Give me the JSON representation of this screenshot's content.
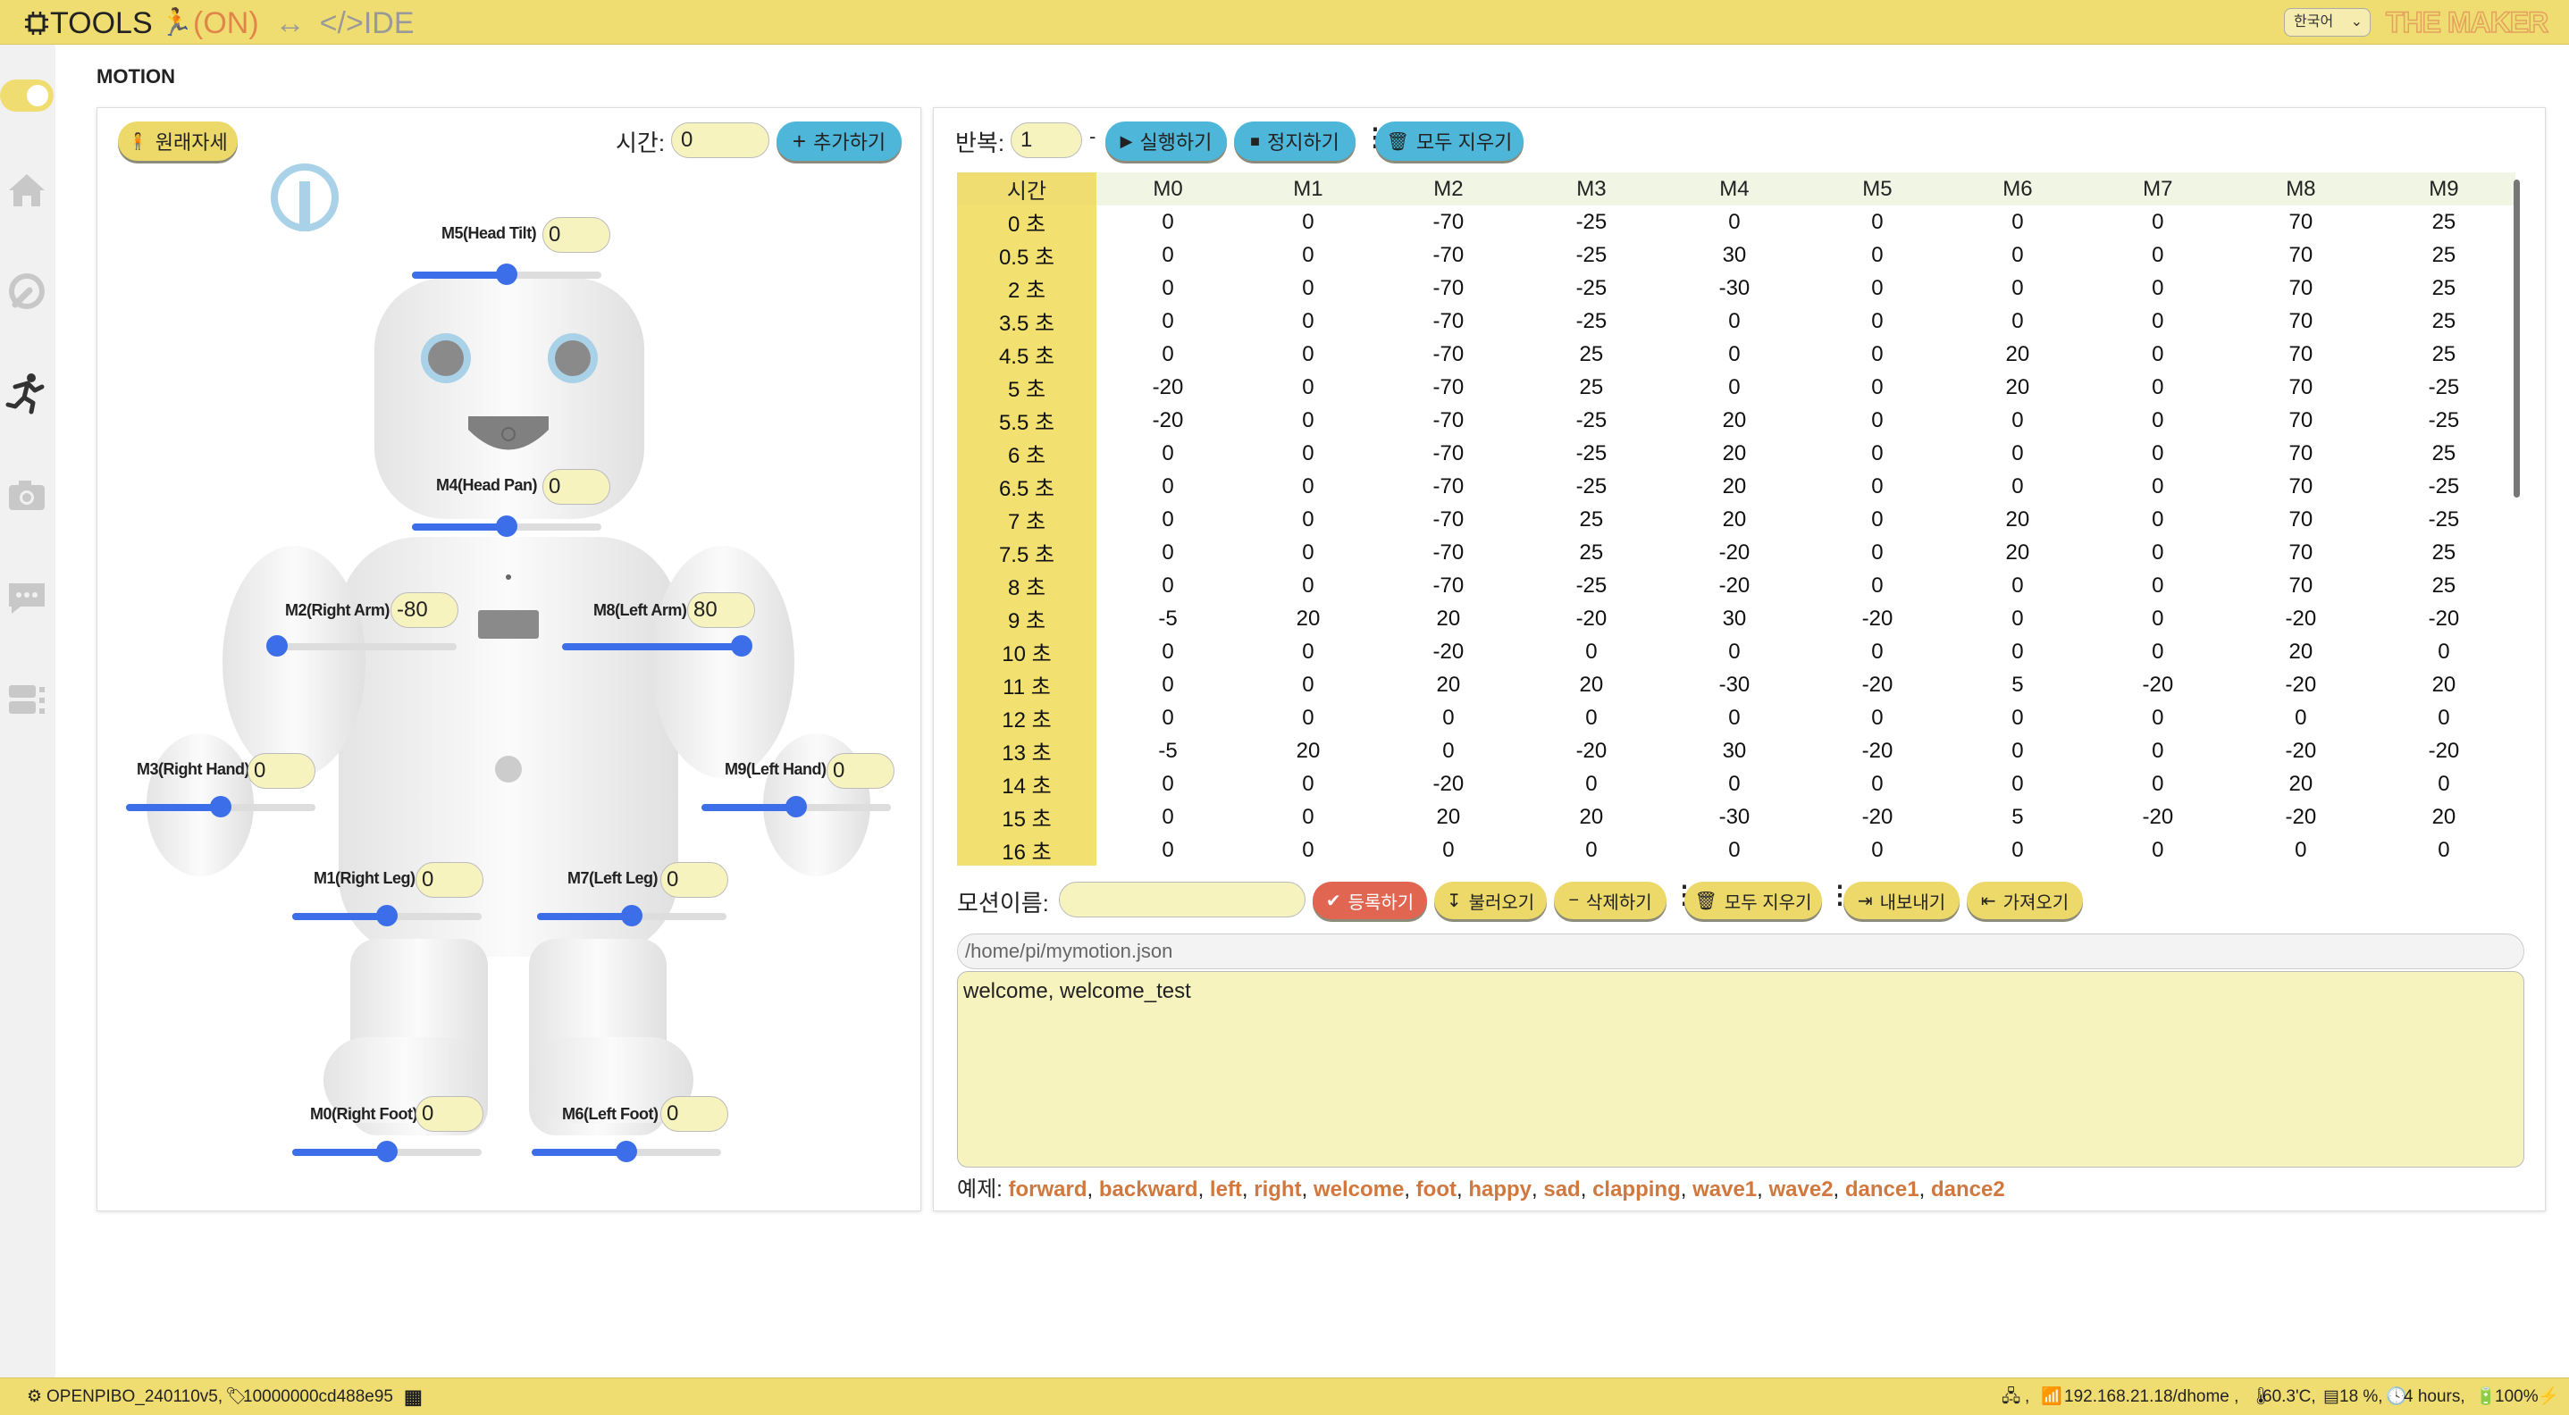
{
  "topbar": {
    "brand_main": "TOOLS",
    "brand_on": "(ON)",
    "brand_arrow": "↔",
    "brand_ide": "</>IDE",
    "language": "한국어",
    "logo": "THE MAKER"
  },
  "page": {
    "title": "MOTION"
  },
  "sidebar": {
    "items": [
      {
        "name": "home",
        "icon": "home-icon"
      },
      {
        "name": "tools",
        "icon": "wrench-icon"
      },
      {
        "name": "motion",
        "icon": "running-person-icon"
      },
      {
        "name": "camera",
        "icon": "camera-icon"
      },
      {
        "name": "chat",
        "icon": "chat-icon"
      },
      {
        "name": "devices",
        "icon": "device-icon"
      }
    ]
  },
  "left": {
    "reset_label": "원래자세",
    "time_label": "시간:",
    "time_value": "0",
    "add_label": "추가하기",
    "motors": [
      {
        "id": "m5",
        "label": "M5(Head Tilt)",
        "value": "0",
        "level": 0.5
      },
      {
        "id": "m4",
        "label": "M4(Head Pan)",
        "value": "0",
        "level": 0.5
      },
      {
        "id": "m2",
        "label": "M2(Right Arm)",
        "value": "-80",
        "level": 0.05
      },
      {
        "id": "m8",
        "label": "M8(Left Arm)",
        "value": "80",
        "level": 0.95
      },
      {
        "id": "m3",
        "label": "M3(Right Hand)",
        "value": "0",
        "level": 0.5
      },
      {
        "id": "m9",
        "label": "M9(Left Hand)",
        "value": "0",
        "level": 0.5
      },
      {
        "id": "m1",
        "label": "M1(Right Leg)",
        "value": "0",
        "level": 0.5
      },
      {
        "id": "m7",
        "label": "M7(Left Leg)",
        "value": "0",
        "level": 0.5
      },
      {
        "id": "m0",
        "label": "M0(Right Foot)",
        "value": "0",
        "level": 0.5
      },
      {
        "id": "m6",
        "label": "M6(Left Foot)",
        "value": "0",
        "level": 0.5
      }
    ]
  },
  "right": {
    "repeat_label": "반복:",
    "repeat_value": "1",
    "dash": "-",
    "run_label": "실행하기",
    "stop_label": "정지하기",
    "clear_all_label": "모두 지우기",
    "table": {
      "headers": [
        "시간",
        "M0",
        "M1",
        "M2",
        "M3",
        "M4",
        "M5",
        "M6",
        "M7",
        "M8",
        "M9"
      ],
      "rows": [
        [
          "0 초",
          "0",
          "0",
          "-70",
          "-25",
          "0",
          "0",
          "0",
          "0",
          "70",
          "25"
        ],
        [
          "0.5 초",
          "0",
          "0",
          "-70",
          "-25",
          "30",
          "0",
          "0",
          "0",
          "70",
          "25"
        ],
        [
          "2 초",
          "0",
          "0",
          "-70",
          "-25",
          "-30",
          "0",
          "0",
          "0",
          "70",
          "25"
        ],
        [
          "3.5 초",
          "0",
          "0",
          "-70",
          "-25",
          "0",
          "0",
          "0",
          "0",
          "70",
          "25"
        ],
        [
          "4.5 초",
          "0",
          "0",
          "-70",
          "25",
          "0",
          "0",
          "20",
          "0",
          "70",
          "25"
        ],
        [
          "5 초",
          "-20",
          "0",
          "-70",
          "25",
          "0",
          "0",
          "20",
          "0",
          "70",
          "-25"
        ],
        [
          "5.5 초",
          "-20",
          "0",
          "-70",
          "-25",
          "20",
          "0",
          "0",
          "0",
          "70",
          "-25"
        ],
        [
          "6 초",
          "0",
          "0",
          "-70",
          "-25",
          "20",
          "0",
          "0",
          "0",
          "70",
          "25"
        ],
        [
          "6.5 초",
          "0",
          "0",
          "-70",
          "-25",
          "20",
          "0",
          "0",
          "0",
          "70",
          "-25"
        ],
        [
          "7 초",
          "0",
          "0",
          "-70",
          "25",
          "20",
          "0",
          "20",
          "0",
          "70",
          "-25"
        ],
        [
          "7.5 초",
          "0",
          "0",
          "-70",
          "25",
          "-20",
          "0",
          "20",
          "0",
          "70",
          "25"
        ],
        [
          "8 초",
          "0",
          "0",
          "-70",
          "-25",
          "-20",
          "0",
          "0",
          "0",
          "70",
          "25"
        ],
        [
          "9 초",
          "-5",
          "20",
          "20",
          "-20",
          "30",
          "-20",
          "0",
          "0",
          "-20",
          "-20"
        ],
        [
          "10 초",
          "0",
          "0",
          "-20",
          "0",
          "0",
          "0",
          "0",
          "0",
          "20",
          "0"
        ],
        [
          "11 초",
          "0",
          "0",
          "20",
          "20",
          "-30",
          "-20",
          "5",
          "-20",
          "-20",
          "20"
        ],
        [
          "12 초",
          "0",
          "0",
          "0",
          "0",
          "0",
          "0",
          "0",
          "0",
          "0",
          "0"
        ],
        [
          "13 초",
          "-5",
          "20",
          "0",
          "-20",
          "30",
          "-20",
          "0",
          "0",
          "-20",
          "-20"
        ],
        [
          "14 초",
          "0",
          "0",
          "-20",
          "0",
          "0",
          "0",
          "0",
          "0",
          "20",
          "0"
        ],
        [
          "15 초",
          "0",
          "0",
          "20",
          "20",
          "-30",
          "-20",
          "5",
          "-20",
          "-20",
          "20"
        ],
        [
          "16 초",
          "0",
          "0",
          "0",
          "0",
          "0",
          "0",
          "0",
          "0",
          "0",
          "0"
        ]
      ]
    },
    "motion_name_label": "모션이름:",
    "motion_name_value": "",
    "register_label": "등록하기",
    "load_label": "불러오기",
    "delete_label": "삭제하기",
    "clear_all2_label": "모두 지우기",
    "export_label": "내보내기",
    "import_label": "가져오기",
    "file_path": "/home/pi/mymotion.json",
    "motion_list": "welcome, welcome_test",
    "examples_label": "예제:",
    "examples": [
      "forward",
      "backward",
      "left",
      "right",
      "welcome",
      "foot",
      "happy",
      "sad",
      "clapping",
      "wave1",
      "wave2",
      "dance1",
      "dance2"
    ]
  },
  "footer": {
    "device": "OPENPIBO_240110v5,",
    "serial": "10000000cd488e95",
    "network": ",",
    "ip": "192.168.21.18/dhome ,",
    "temp": "60.3'C,",
    "cpu": "18 %,",
    "uptime": "4 hours,",
    "battery": "100%"
  },
  "colors": {
    "accent": "#f0dd72",
    "blue": "#4db6d9",
    "red": "#e06651",
    "slider": "#3b6ee8",
    "link": "#d0783e"
  }
}
